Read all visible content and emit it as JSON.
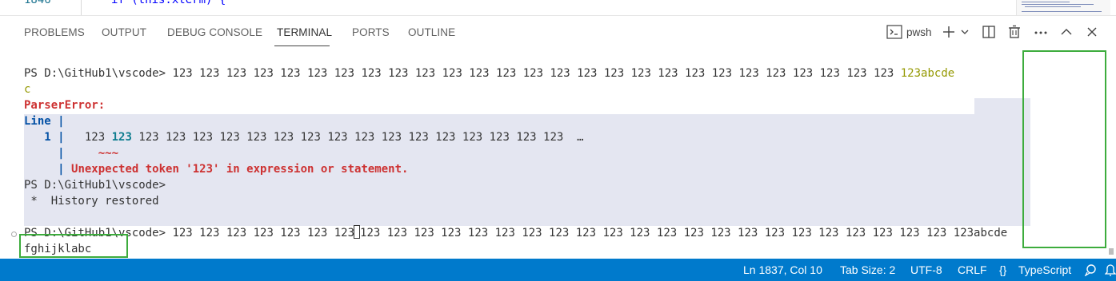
{
  "editor": {
    "line_number": "1846",
    "code": "if (this.xterm) {"
  },
  "panel": {
    "tabs": [
      {
        "label": "PROBLEMS"
      },
      {
        "label": "OUTPUT"
      },
      {
        "label": "DEBUG CONSOLE"
      },
      {
        "label": "TERMINAL"
      },
      {
        "label": "PORTS"
      },
      {
        "label": "OUTLINE"
      }
    ],
    "active_tab": "TERMINAL",
    "terminal_profile": "pwsh"
  },
  "terminal": {
    "prompt": "PS D:\\GitHub1\\vscode>",
    "line1_text": " 123 123 123 123 123 123 123 123 123 123 123 123 123 123 123 123 123 123 123 123 123 123 123 123 123 123 123 ",
    "line1_tail": "123abcde",
    "line2": "c",
    "error_title": "ParserError:",
    "line_label": "Line |",
    "line_number_label": "   1 |",
    "line_number_value": "1",
    "code_prefix": "   123 ",
    "code_highlight": "123",
    "code_rest": " 123 123 123 123 123 123 123 123 123 123 123 123 123 123 123 123  …",
    "squiggle": "~~~",
    "error_message": "Unexpected token '123' in expression or statement.",
    "history_restored": " *  History restored",
    "current_before_cursor": " 123 123 123 123 123 123 123",
    "current_after_cursor": "123 123 123 123 123 123 123 123 123 123 123 123 123 123 123 123 123 123 123 123 123 123 ",
    "current_tail": "123abcde",
    "current_wrap": "fghijklabc"
  },
  "status_bar": {
    "position": "Ln 1837, Col 10",
    "tab_size": "Tab Size: 2",
    "encoding": "UTF-8",
    "eol": "CRLF",
    "language_icon": "{}",
    "language": "TypeScript"
  },
  "colors": {
    "status_bar": "#007acc",
    "selection_highlight": "#e4e6f1",
    "error_red": "#cd3131",
    "annotation_green": "#3dac3d"
  }
}
